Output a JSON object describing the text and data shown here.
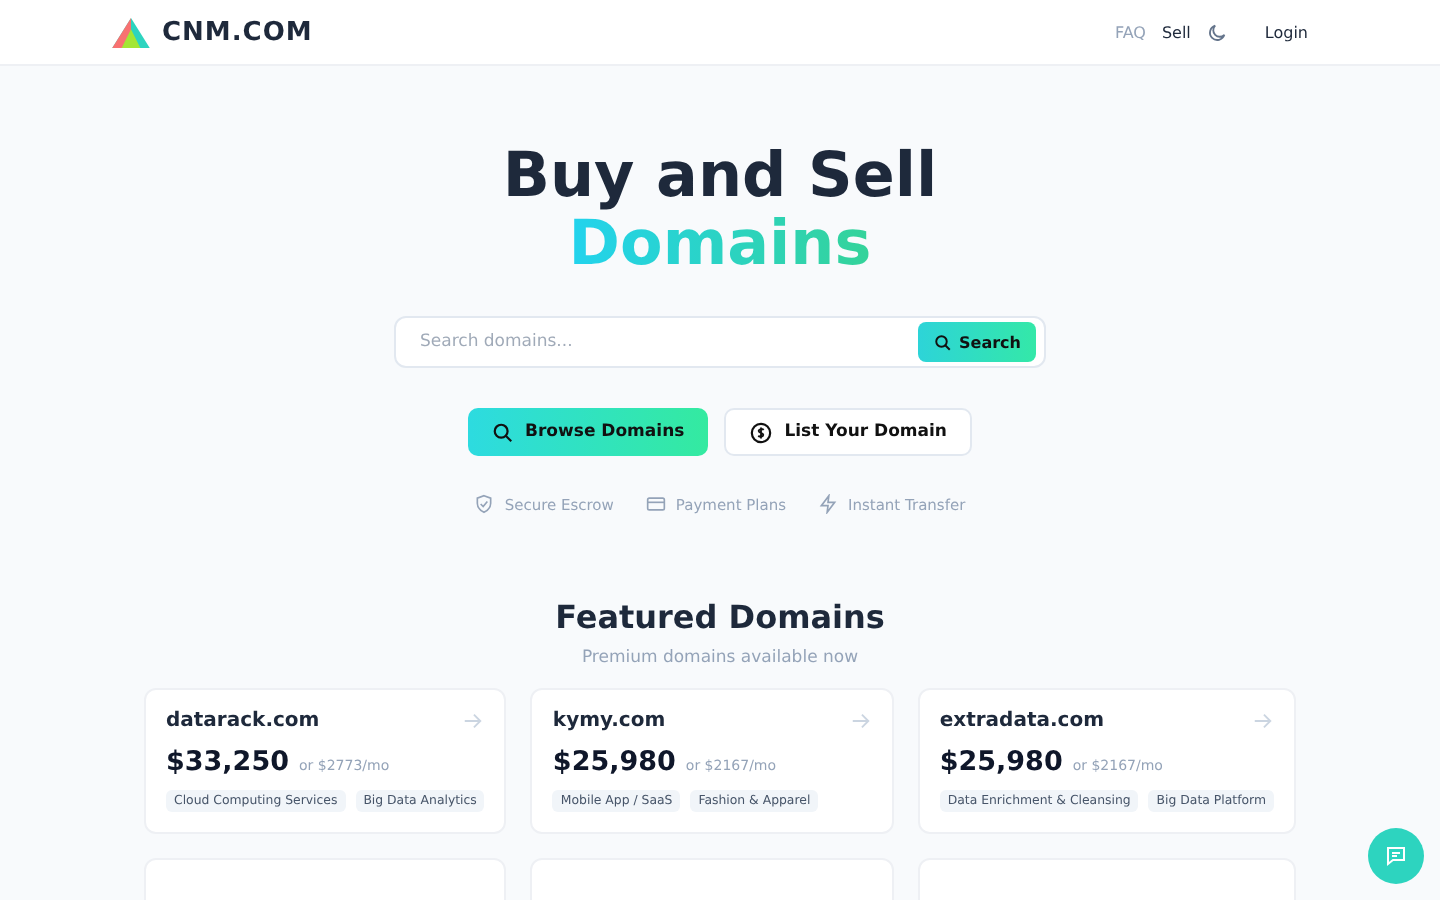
{
  "header": {
    "logo": "CNM.COM",
    "nav": [
      {
        "label": "FAQ",
        "selected": false
      },
      {
        "label": "Sell",
        "selected": true
      }
    ],
    "login": "Login"
  },
  "hero": {
    "title": "Buy and Sell",
    "highlight": "Domains",
    "search": {
      "placeholder": "Search domains...",
      "button": "Search"
    },
    "actions": [
      {
        "kind": "primary",
        "label": "Browse Domains"
      },
      {
        "kind": "secondary",
        "label": "List Your Domain"
      }
    ],
    "features": [
      {
        "kind": "shield",
        "label": "Secure Escrow"
      },
      {
        "kind": "card",
        "label": "Payment Plans"
      },
      {
        "kind": "bolt",
        "label": "Instant Transfer"
      }
    ]
  },
  "featured": {
    "title": "Featured Domains",
    "subtitle": "Premium domains available now",
    "domains": [
      {
        "name": "datarack.com",
        "price": "$33,250",
        "monthly": "or $2773/mo",
        "tags": [
          "Cloud Computing Services",
          "Big Data Analytics"
        ]
      },
      {
        "name": "kymy.com",
        "price": "$25,980",
        "monthly": "or $2167/mo",
        "tags": [
          "Mobile App / SaaS",
          "Fashion & Apparel"
        ]
      },
      {
        "name": "extradata.com",
        "price": "$25,980",
        "monthly": "or $2167/mo",
        "tags": [
          "Data Enrichment & Cleansing",
          "Big Data Platform"
        ]
      }
    ]
  }
}
